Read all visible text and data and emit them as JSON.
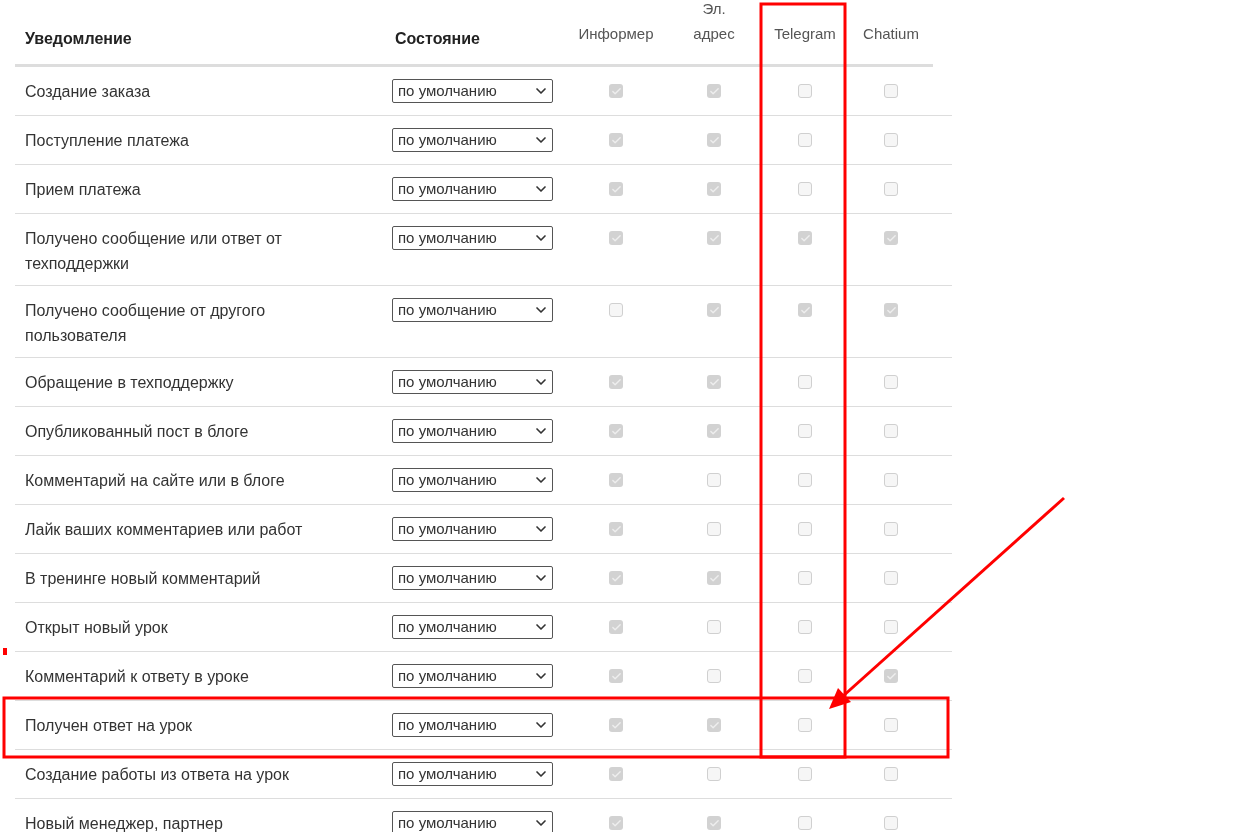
{
  "table": {
    "columns": [
      {
        "label": "Уведомление",
        "kind": "text"
      },
      {
        "label": "Состояние",
        "kind": "text"
      },
      {
        "label": "Информер",
        "kind": "channel"
      },
      {
        "label": "Эл.\nадрес",
        "kind": "channel"
      },
      {
        "label": "Telegram",
        "kind": "channel"
      },
      {
        "label": "Chatium",
        "kind": "channel"
      }
    ],
    "rows": [
      {
        "name": "Создание заказа",
        "state": "по умолчанию",
        "checks": [
          true,
          true,
          false,
          false
        ]
      },
      {
        "name": "Поступление платежа",
        "state": "по умолчанию",
        "checks": [
          true,
          true,
          false,
          false
        ]
      },
      {
        "name": "Прием платежа",
        "state": "по умолчанию",
        "checks": [
          true,
          true,
          false,
          false
        ]
      },
      {
        "name": "Получено сообщение или ответ от техподдержки",
        "state": "по умолчанию",
        "checks": [
          true,
          true,
          true,
          true
        ]
      },
      {
        "name": "Получено сообщение от другого пользователя",
        "state": "по умолчанию",
        "checks": [
          false,
          true,
          true,
          true
        ]
      },
      {
        "name": "Обращение в техподдержку",
        "state": "по умолчанию",
        "checks": [
          true,
          true,
          false,
          false
        ]
      },
      {
        "name": "Опубликованный пост в блоге",
        "state": "по умолчанию",
        "checks": [
          true,
          true,
          false,
          false
        ]
      },
      {
        "name": "Комментарий на сайте или в блоге",
        "state": "по умолчанию",
        "checks": [
          true,
          false,
          false,
          false
        ]
      },
      {
        "name": "Лайк ваших комментариев или работ",
        "state": "по умолчанию",
        "checks": [
          true,
          false,
          false,
          false
        ]
      },
      {
        "name": "В тренинге новый комментарий",
        "state": "по умолчанию",
        "checks": [
          true,
          true,
          false,
          false
        ]
      },
      {
        "name": "Открыт новый урок",
        "state": "по умолчанию",
        "checks": [
          true,
          false,
          false,
          false
        ]
      },
      {
        "name": "Комментарий к ответу в уроке",
        "state": "по умолчанию",
        "checks": [
          true,
          false,
          false,
          true
        ]
      },
      {
        "name": "Получен ответ на урок",
        "state": "по умолчанию",
        "checks": [
          true,
          true,
          false,
          false
        ]
      },
      {
        "name": "Создание работы из ответа на урок",
        "state": "по умолчанию",
        "checks": [
          true,
          false,
          false,
          false
        ]
      },
      {
        "name": "Новый менеджер, партнер",
        "state": "по умолчанию",
        "checks": [
          true,
          true,
          false,
          false
        ]
      }
    ]
  }
}
